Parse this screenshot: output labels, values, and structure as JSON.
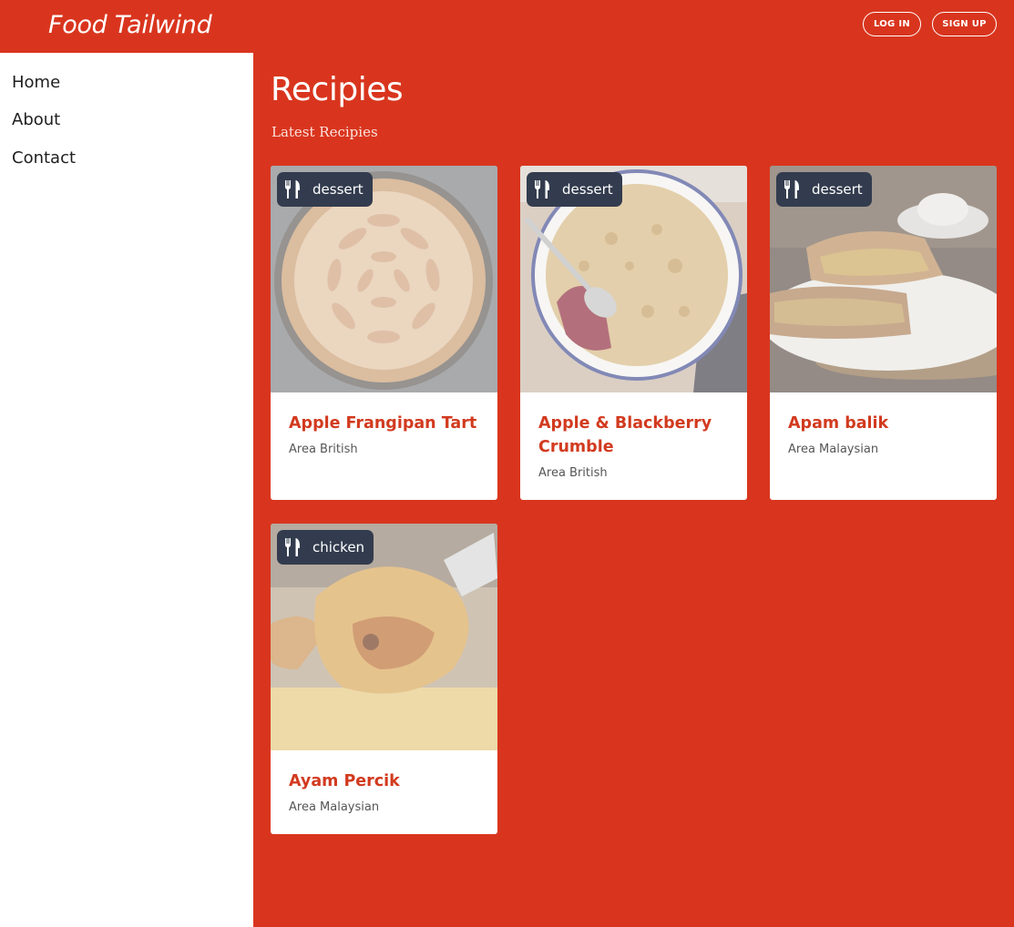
{
  "header": {
    "brand": "Food Tailwind",
    "login_label": "LOG IN",
    "signup_label": "SIGN UP"
  },
  "sidebar": {
    "items": [
      {
        "label": "Home"
      },
      {
        "label": "About"
      },
      {
        "label": "Contact"
      }
    ]
  },
  "main": {
    "title": "Recipies",
    "subtitle": "Latest Recipies"
  },
  "recipes": [
    {
      "category": "dessert",
      "icon": "utensils-icon",
      "title": "Apple Frangipan Tart",
      "area": "Area British"
    },
    {
      "category": "dessert",
      "icon": "utensils-icon",
      "title": "Apple & Blackberry Crumble",
      "area": "Area British"
    },
    {
      "category": "dessert",
      "icon": "utensils-icon",
      "title": "Apam balik",
      "area": "Area Malaysian"
    },
    {
      "category": "chicken",
      "icon": "utensils-icon",
      "title": "Ayam Percik",
      "area": "Area Malaysian"
    }
  ],
  "colors": {
    "brand": "#d9351e",
    "badge": "#333c4e",
    "card_title": "#d23a1f"
  }
}
